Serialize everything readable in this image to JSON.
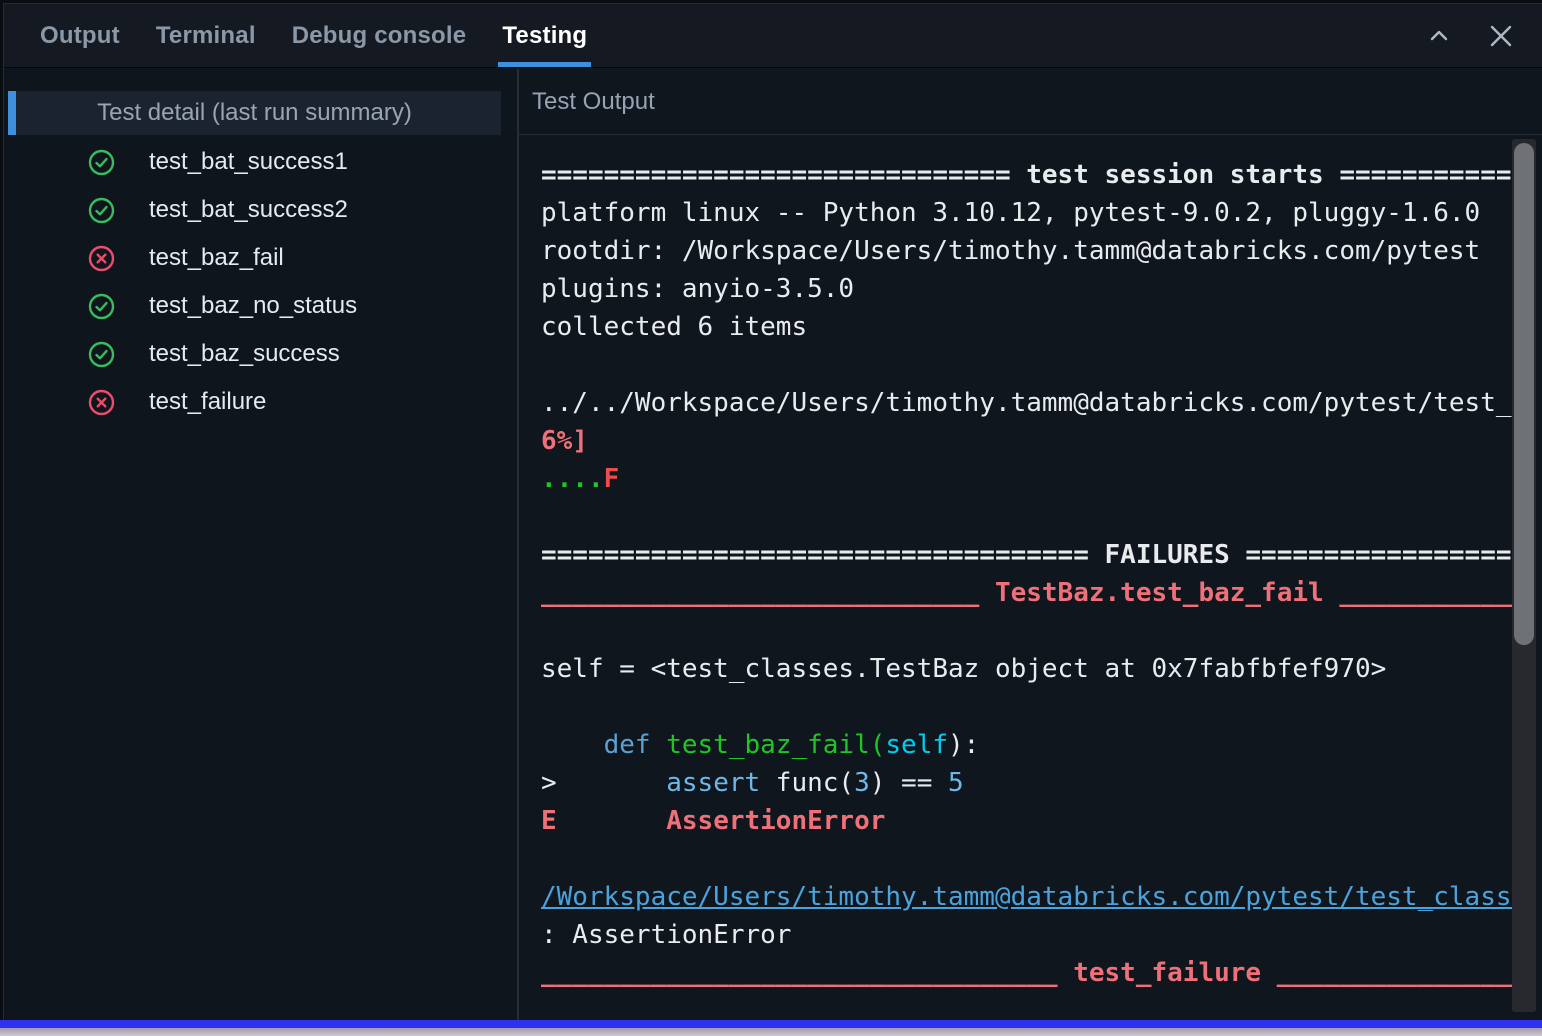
{
  "tab_bar": {
    "tabs": [
      {
        "label": "Output",
        "active": false
      },
      {
        "label": "Terminal",
        "active": false
      },
      {
        "label": "Debug console",
        "active": false
      },
      {
        "label": "Testing",
        "active": true
      }
    ],
    "controls": [
      {
        "icon": "chevron-up-icon"
      },
      {
        "icon": "close-icon"
      }
    ]
  },
  "sidebar": {
    "header": "Test detail (last run summary)",
    "tests": [
      {
        "name": "test_bat_success1",
        "status": "pass"
      },
      {
        "name": "test_bat_success2",
        "status": "pass"
      },
      {
        "name": "test_baz_fail",
        "status": "fail"
      },
      {
        "name": "test_baz_no_status",
        "status": "pass"
      },
      {
        "name": "test_baz_success",
        "status": "pass"
      },
      {
        "name": "test_failure",
        "status": "fail"
      }
    ]
  },
  "output_panel": {
    "header": "Test Output",
    "lines": [
      {
        "segments": [
          {
            "text": "============================== test session starts =============================================",
            "color": "white",
            "bold": true
          }
        ]
      },
      {
        "segments": [
          {
            "text": "platform linux -- Python 3.10.12, pytest-9.0.2, pluggy-1.6.0",
            "color": "white"
          }
        ]
      },
      {
        "segments": [
          {
            "text": "rootdir: /Workspace/Users/timothy.tamm@databricks.com/pytest",
            "color": "white"
          }
        ]
      },
      {
        "segments": [
          {
            "text": "plugins: anyio-3.5.0",
            "color": "white"
          }
        ]
      },
      {
        "segments": [
          {
            "text": "collected 6 items",
            "color": "white"
          }
        ]
      },
      {
        "segments": []
      },
      {
        "segments": [
          {
            "text": "../../Workspace/Users/timothy.tamm@databricks.com/pytest/test_classes.py",
            "color": "white"
          }
        ]
      },
      {
        "segments": [
          {
            "text": "6%]",
            "color": "salmon",
            "bold": true
          }
        ]
      },
      {
        "segments": [
          {
            "text": "....",
            "color": "green",
            "bold": true
          },
          {
            "text": "F",
            "color": "red",
            "bold": true
          }
        ]
      },
      {
        "segments": []
      },
      {
        "segments": [
          {
            "text": "=================================== FAILURES =============================================",
            "color": "white",
            "bold": true
          }
        ]
      },
      {
        "segments": [
          {
            "text": "____________________________ TestBaz.test_baz_fail ________________________________________",
            "color": "salmon",
            "bold": true
          }
        ]
      },
      {
        "segments": []
      },
      {
        "segments": [
          {
            "text": "self = <test_classes.TestBaz object at 0x7fabfbfef970>",
            "color": "white"
          }
        ]
      },
      {
        "segments": []
      },
      {
        "segments": [
          {
            "text": "    ",
            "color": "white"
          },
          {
            "text": "def",
            "color": "blue"
          },
          {
            "text": " ",
            "color": "white"
          },
          {
            "text": "test_baz_fail(",
            "color": "green"
          },
          {
            "text": "self",
            "color": "cyan"
          },
          {
            "text": "):",
            "color": "white"
          }
        ]
      },
      {
        "segments": [
          {
            "text": ">       ",
            "color": "white"
          },
          {
            "text": "assert",
            "color": "lightblue"
          },
          {
            "text": " func(",
            "color": "white"
          },
          {
            "text": "3",
            "color": "lightblue"
          },
          {
            "text": ") == ",
            "color": "white"
          },
          {
            "text": "5",
            "color": "lightblue"
          }
        ]
      },
      {
        "segments": [
          {
            "text": "E",
            "color": "salmon",
            "bold": true
          },
          {
            "text": "       ",
            "color": "white"
          },
          {
            "text": "AssertionError",
            "color": "salmon",
            "bold": true
          }
        ]
      },
      {
        "segments": []
      },
      {
        "segments": [
          {
            "text": "/Workspace/Users/timothy.tamm@databricks.com/pytest/test_classes.py",
            "color": "link",
            "link": true
          }
        ]
      },
      {
        "segments": [
          {
            "text": ": AssertionError",
            "color": "white"
          }
        ]
      },
      {
        "segments": [
          {
            "text": "_________________________________ test_failure ____________________________________________",
            "color": "salmon",
            "bold": true
          }
        ]
      }
    ]
  },
  "colors": {
    "accent_blue": "#3f90dc",
    "pass_green": "#3cb961",
    "fail_red": "#e84f6d",
    "ansi": {
      "white": "#e9ecef",
      "salmon": "#ef7078",
      "red": "#f14c4c",
      "green": "#1fc527",
      "blue": "#5ca0d3",
      "cyan": "#00cdee",
      "lightblue": "#6fb7e8",
      "link": "#4ba3dd"
    }
  }
}
